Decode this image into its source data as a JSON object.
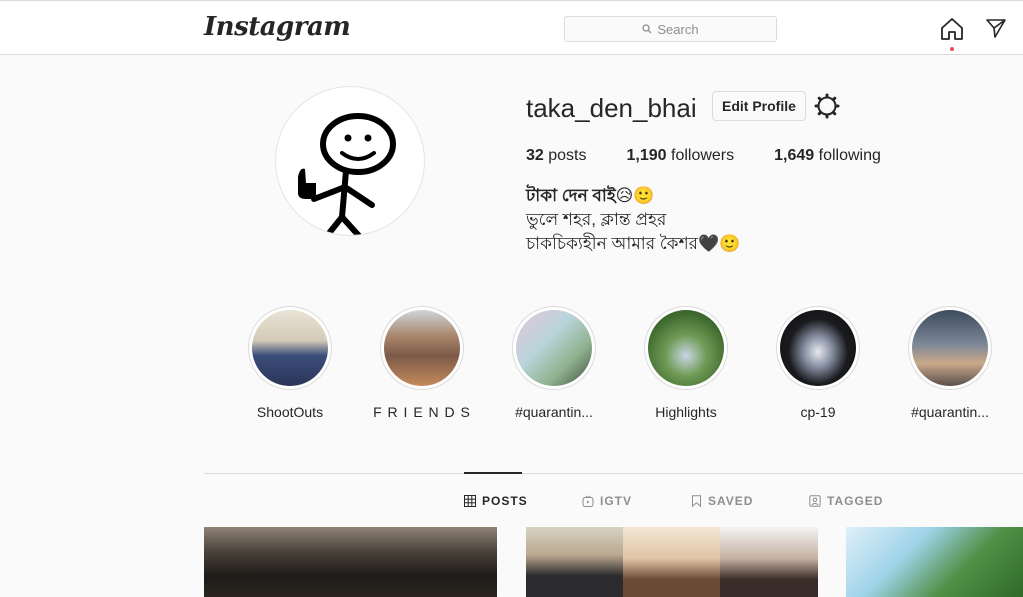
{
  "header": {
    "logo": "Instagram",
    "search_placeholder": "Search",
    "icons": [
      "search-icon",
      "home-icon",
      "direct-message-icon"
    ]
  },
  "profile": {
    "username": "taka_den_bhai",
    "edit_profile_label": "Edit Profile",
    "stats": {
      "posts_count": "32",
      "posts_label": "posts",
      "followers_count": "1,190",
      "followers_label": "followers",
      "following_count": "1,649",
      "following_label": "following"
    },
    "bio": {
      "name": "টাকা দেন বাই😥🙂",
      "line1": "ভুলে শহর, ক্লান্ত প্রহর",
      "line2": "চাকচিক্যহীন আমার কৈশর🖤🙂"
    }
  },
  "highlights": [
    {
      "label": "ShootOuts"
    },
    {
      "label": "F R I E N D S"
    },
    {
      "label": "#quarantin..."
    },
    {
      "label": "Highlights"
    },
    {
      "label": "cp-19"
    },
    {
      "label": "#quarantin..."
    }
  ],
  "tabs": [
    {
      "label": "POSTS",
      "icon": "grid-icon",
      "active": true
    },
    {
      "label": "IGTV",
      "icon": "igtv-icon",
      "active": false
    },
    {
      "label": "SAVED",
      "icon": "bookmark-icon",
      "active": false
    },
    {
      "label": "TAGGED",
      "icon": "tagged-icon",
      "active": false
    }
  ],
  "colors": {
    "text": "#262626",
    "secondary": "#8e8e8e",
    "border": "#dbdbdb",
    "background": "#fafafa",
    "notification_dot": "#ed4956"
  }
}
